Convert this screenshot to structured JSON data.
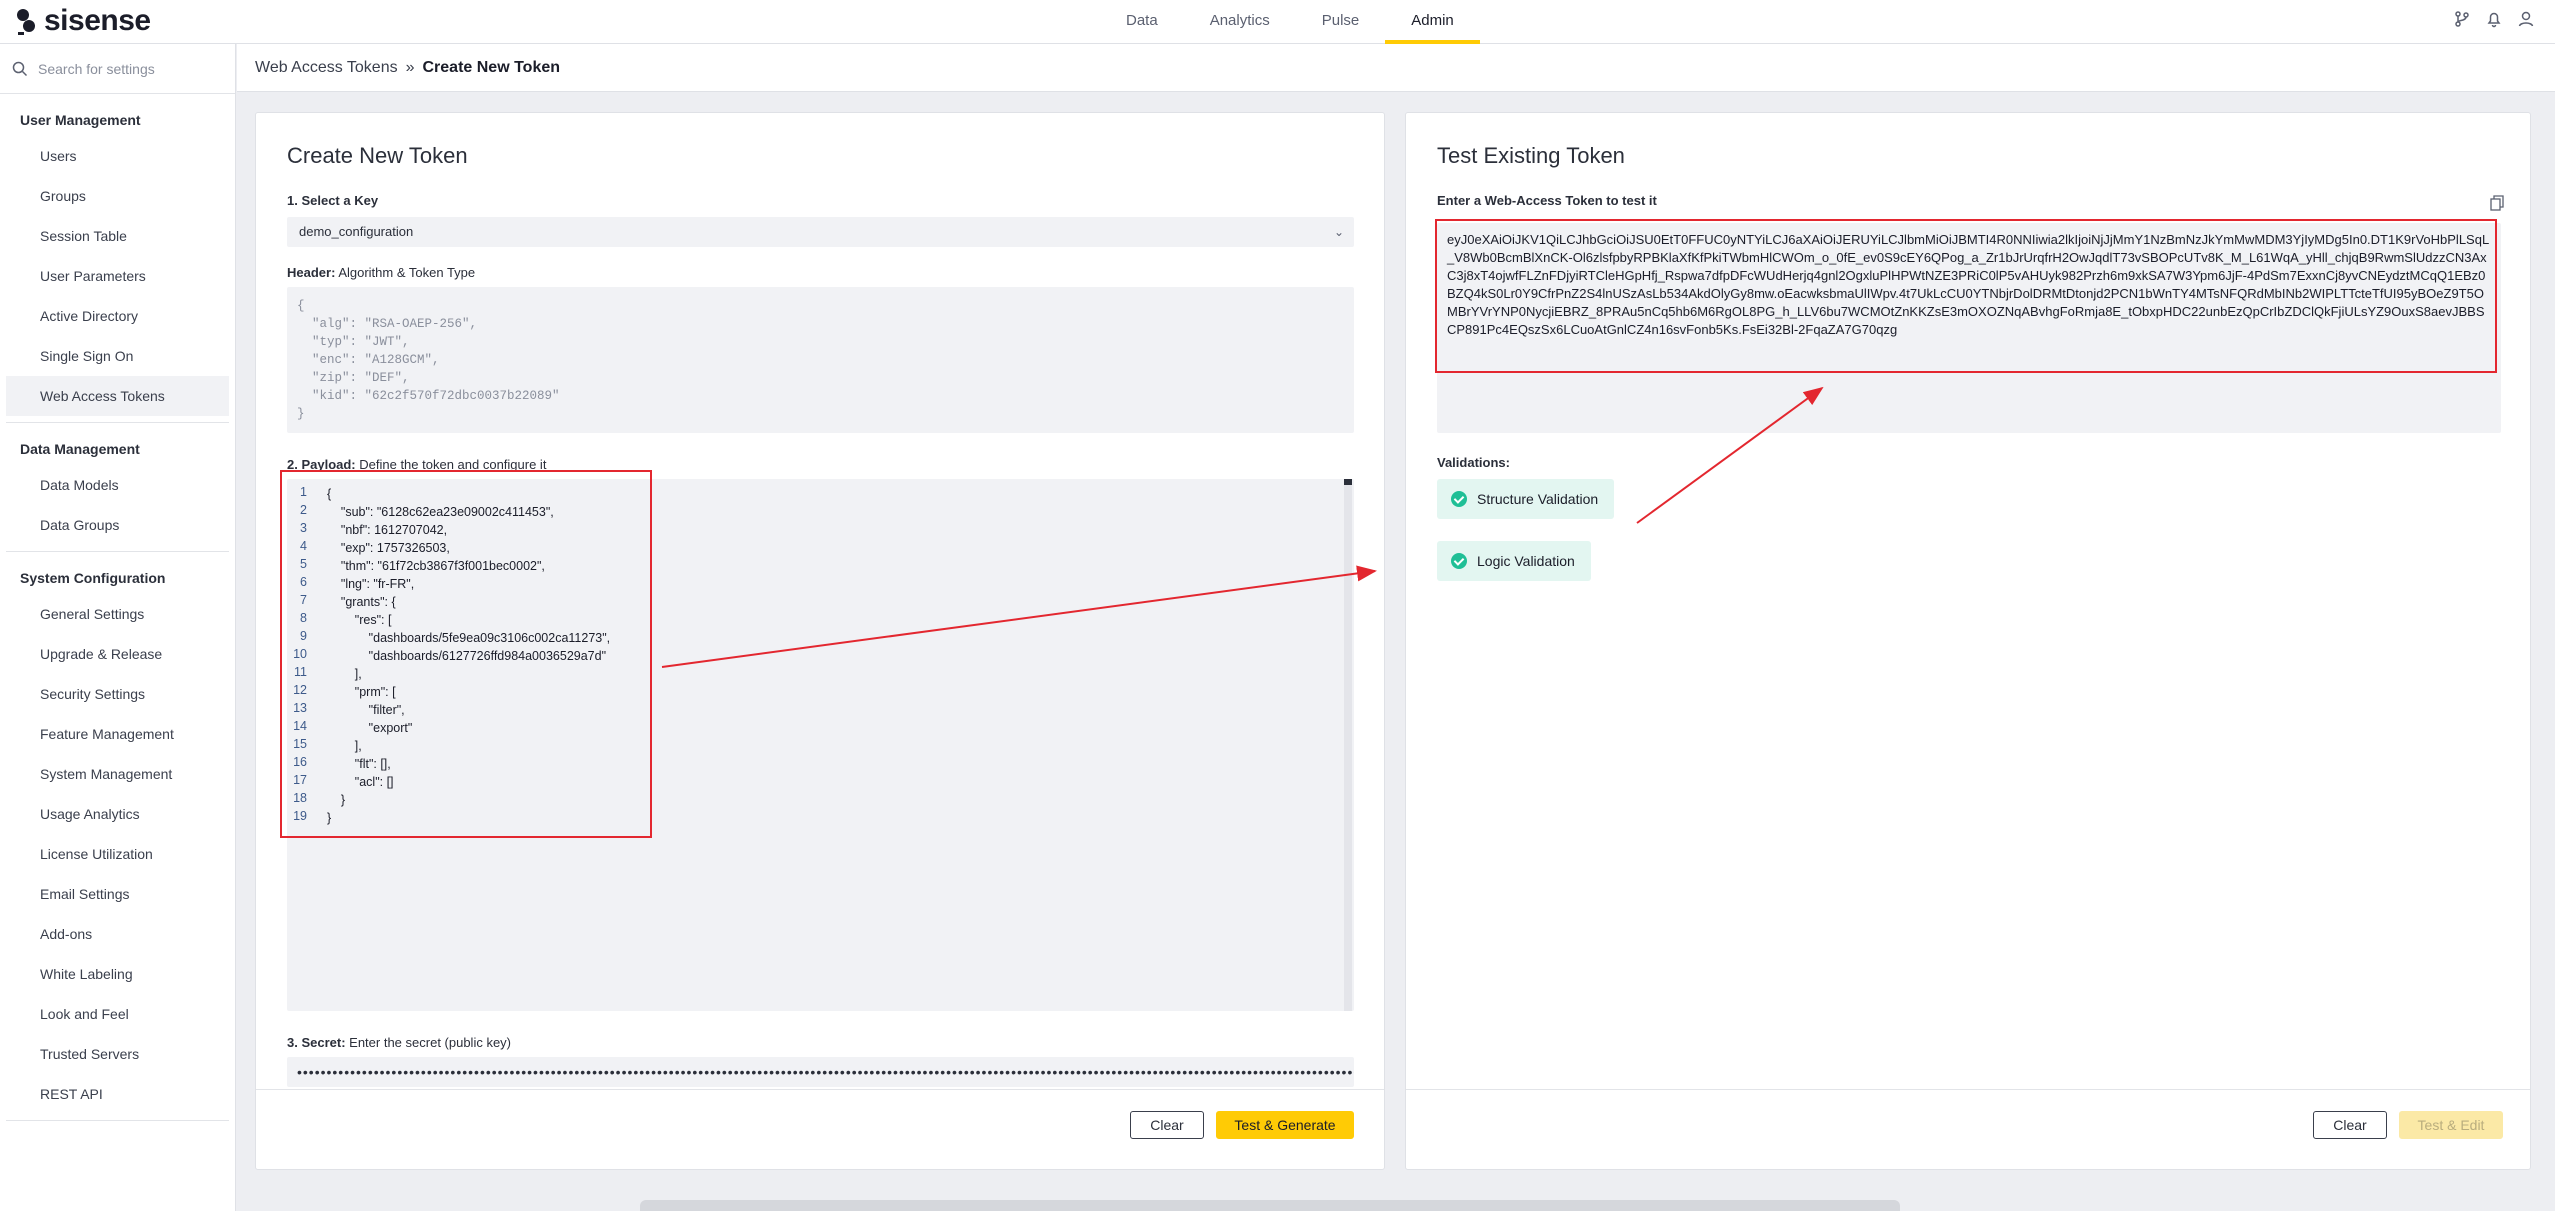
{
  "app": {
    "brand": "sisense"
  },
  "topnav": {
    "items": [
      "Data",
      "Analytics",
      "Pulse",
      "Admin"
    ],
    "active": "Admin"
  },
  "topicons": [
    "git-branch-icon",
    "bell-icon",
    "user-icon"
  ],
  "sidebar": {
    "search_placeholder": "Search for settings",
    "sections": [
      {
        "header": "User Management",
        "items": [
          "Users",
          "Groups",
          "Session Table",
          "User Parameters",
          "Active Directory",
          "Single Sign On",
          "Web Access Tokens"
        ]
      },
      {
        "header": "Data Management",
        "items": [
          "Data Models",
          "Data Groups"
        ]
      },
      {
        "header": "System Configuration",
        "items": [
          "General Settings",
          "Upgrade & Release",
          "Security Settings",
          "Feature Management",
          "System Management",
          "Usage Analytics",
          "License Utilization",
          "Email Settings",
          "Add-ons",
          "White Labeling",
          "Look and Feel",
          "Trusted Servers",
          "REST API"
        ]
      }
    ],
    "active_item": "Web Access Tokens"
  },
  "breadcrumb": {
    "parent": "Web Access Tokens",
    "separator": "»",
    "current": "Create New Token"
  },
  "create": {
    "title": "Create New Token",
    "key_label_num": "1. Select a Key",
    "key_value": "demo_configuration",
    "header_label_bold": "Header:",
    "header_label_rest": " Algorithm & Token Type",
    "header_lines": [
      "{",
      "  \"alg\": \"RSA-OAEP-256\",",
      "  \"typ\": \"JWT\",",
      "  \"enc\": \"A128GCM\",",
      "  \"zip\": \"DEF\",",
      "  \"kid\": \"62c2f570f72dbc0037b22089\"",
      "}"
    ],
    "payload_label_bold": "2. Payload:",
    "payload_label_rest": " Define the token and configure it",
    "payload_lines": [
      "{",
      "    \"sub\": \"6128c62ea23e09002c411453\",",
      "    \"nbf\": 1612707042,",
      "    \"exp\": 1757326503,",
      "    \"thm\": \"61f72cb3867f3f001bec0002\",",
      "    \"lng\": \"fr-FR\",",
      "    \"grants\": {",
      "        \"res\": [",
      "            \"dashboards/5fe9ea09c3106c002ca11273\",",
      "            \"dashboards/6127726ffd984a0036529a7d\"",
      "        ],",
      "        \"prm\": [",
      "            \"filter\",",
      "            \"export\"",
      "        ],",
      "        \"flt\": [],",
      "        \"acl\": []",
      "    }",
      "}"
    ],
    "secret_label_bold": "3. Secret:",
    "secret_label_rest": " Enter the secret (public key)",
    "secret_masked": "••••••••••••••••••••••••••••••••••••••••••••••••••••••••••••••••••••••••••••••••••••••••••••••••••••••••••••••••••••••••••••••••••••••••••••••••••••••••••••••••••••••••••••••••••••••••••",
    "clear_label": "Clear",
    "generate_label": "Test & Generate"
  },
  "test": {
    "title": "Test Existing Token",
    "input_label": "Enter a Web-Access Token to test it",
    "token_value": "eyJ0eXAiOiJKV1QiLCJhbGciOiJSU0EtT0FFUC0yNTYiLCJ6aXAiOiJERUYiLCJlbmMiOiJBMTI4R0NNIiwia2lkIjoiNjJjMmY1NzBmNzJkYmMwMDM3YjIyMDg5In0.DT1K9rVoHbPlLSqL_V8Wb0BcmBlXnCK-Ol6zlsfpbyRPBKlaXfKfPkiTWbmHlCWOm_o_0fE_ev0S9cEY6QPog_a_Zr1bJrUrqfrH2OwJqdlT73vSBOPcUTv8K_M_L61WqA_yHll_chjqB9RwmSlUdzzCN3AxC3j8xT4ojwfFLZnFDjyiRTCleHGpHfj_Rspwa7dfpDFcWUdHerjq4gnl2OgxluPlHPWtNZE3PRiC0lP5vAHUyk982Przh6m9xkSA7W3Ypm6JjF-4PdSm7ExxnCj8yvCNEydztMCqQ1EBz0BZQ4kS0Lr0Y9CfrPnZ2S4lnUSzAsLb534AkdOlyGy8mw.oEacwksbmaUlIWpv.4t7UkLcCU0YTNbjrDolDRMtDtonjd2PCN1bWnTY4MTsNFQRdMbINb2WIPLTTcteTfUI95yBOeZ9T5OMBrYVrYNP0NycjiEBRZ_8PRAu5nCq5hb6M6RgOL8PG_h_LLV6bu7WCMOtZnKKZsE3mOXOZNqABvhgFoRmja8E_tObxpHDC22unbEzQpCrIbZDClQkFjiULsYZ9OuxS8aevJBBSCP891Pc4EQszSx6LCuoAtGnlCZ4n16svFonb5Ks.FsEi32Bl-2FqaZA7G70qzg",
    "validations_label": "Validations:",
    "validations": [
      "Structure Validation",
      "Logic Validation"
    ],
    "clear_label": "Clear",
    "edit_label": "Test & Edit"
  },
  "colors": {
    "accent": "#ffcb05",
    "success": "#1fbf96",
    "highlight": "#e3272f"
  }
}
